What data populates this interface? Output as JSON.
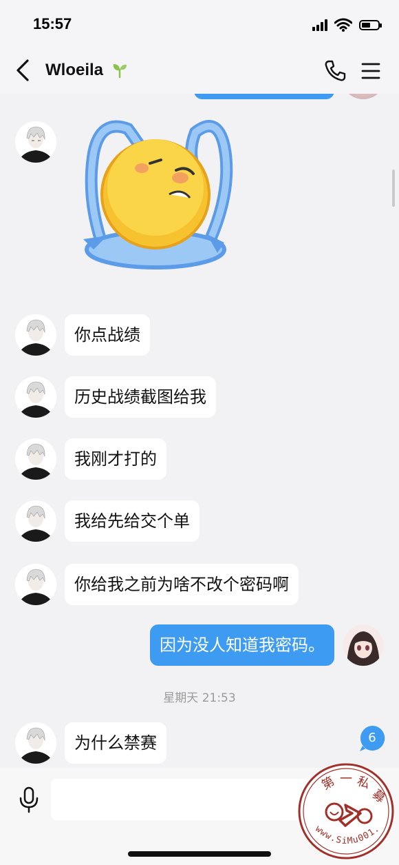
{
  "status_bar": {
    "time": "15:57"
  },
  "nav": {
    "title": "Wloeila"
  },
  "messages": [
    {
      "side": "left",
      "type": "sticker",
      "sticker": "crying-emoji-sticker"
    },
    {
      "side": "left",
      "text": "你点战绩"
    },
    {
      "side": "left",
      "text": "历史战绩截图给我"
    },
    {
      "side": "left",
      "text": "我刚才打的"
    },
    {
      "side": "left",
      "text": "我给先给交个单"
    },
    {
      "side": "left",
      "text": "你给我之前为啥不改个密码啊"
    },
    {
      "side": "right",
      "text": "因为没人知道我密码。"
    },
    {
      "side": "left",
      "text": "为什么禁赛"
    }
  ],
  "timestamp": "星期天 21:53",
  "unread_badge": "6",
  "input": {
    "value": "",
    "placeholder": ""
  },
  "watermark": {
    "text": "第一私募",
    "url": "www.SiMu001.cn"
  },
  "colors": {
    "accent": "#3e9bf2",
    "background": "#f2f2f4"
  }
}
